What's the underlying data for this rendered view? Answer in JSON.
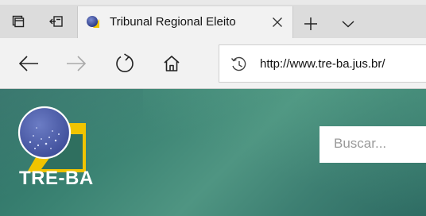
{
  "browser": {
    "tab": {
      "title": "Tribunal Regional Eleito",
      "favicon": "globe-icon"
    },
    "tab_controls": {
      "tab_actions_icon": "tab-actions-icon",
      "set_aside_icon": "set-aside-tabs-icon",
      "new_tab_icon": "plus-icon",
      "tab_list_icon": "chevron-down-icon"
    },
    "nav": {
      "back_icon": "arrow-left-icon",
      "forward_icon": "arrow-right-icon",
      "refresh_icon": "refresh-icon",
      "home_icon": "home-icon"
    },
    "address_bar": {
      "url": "http://www.tre-ba.jus.br/",
      "history_icon": "history-icon"
    }
  },
  "page": {
    "logo_text": "TRE-BA",
    "search": {
      "placeholder": "Buscar..."
    }
  },
  "colors": {
    "tabbar_bg": "#dcdcdc",
    "active_tab_bg": "#f2f2f2",
    "page_green": "#3a8272",
    "logo_blue": "#4a5aa6",
    "logo_yellow": "#f1c400"
  }
}
